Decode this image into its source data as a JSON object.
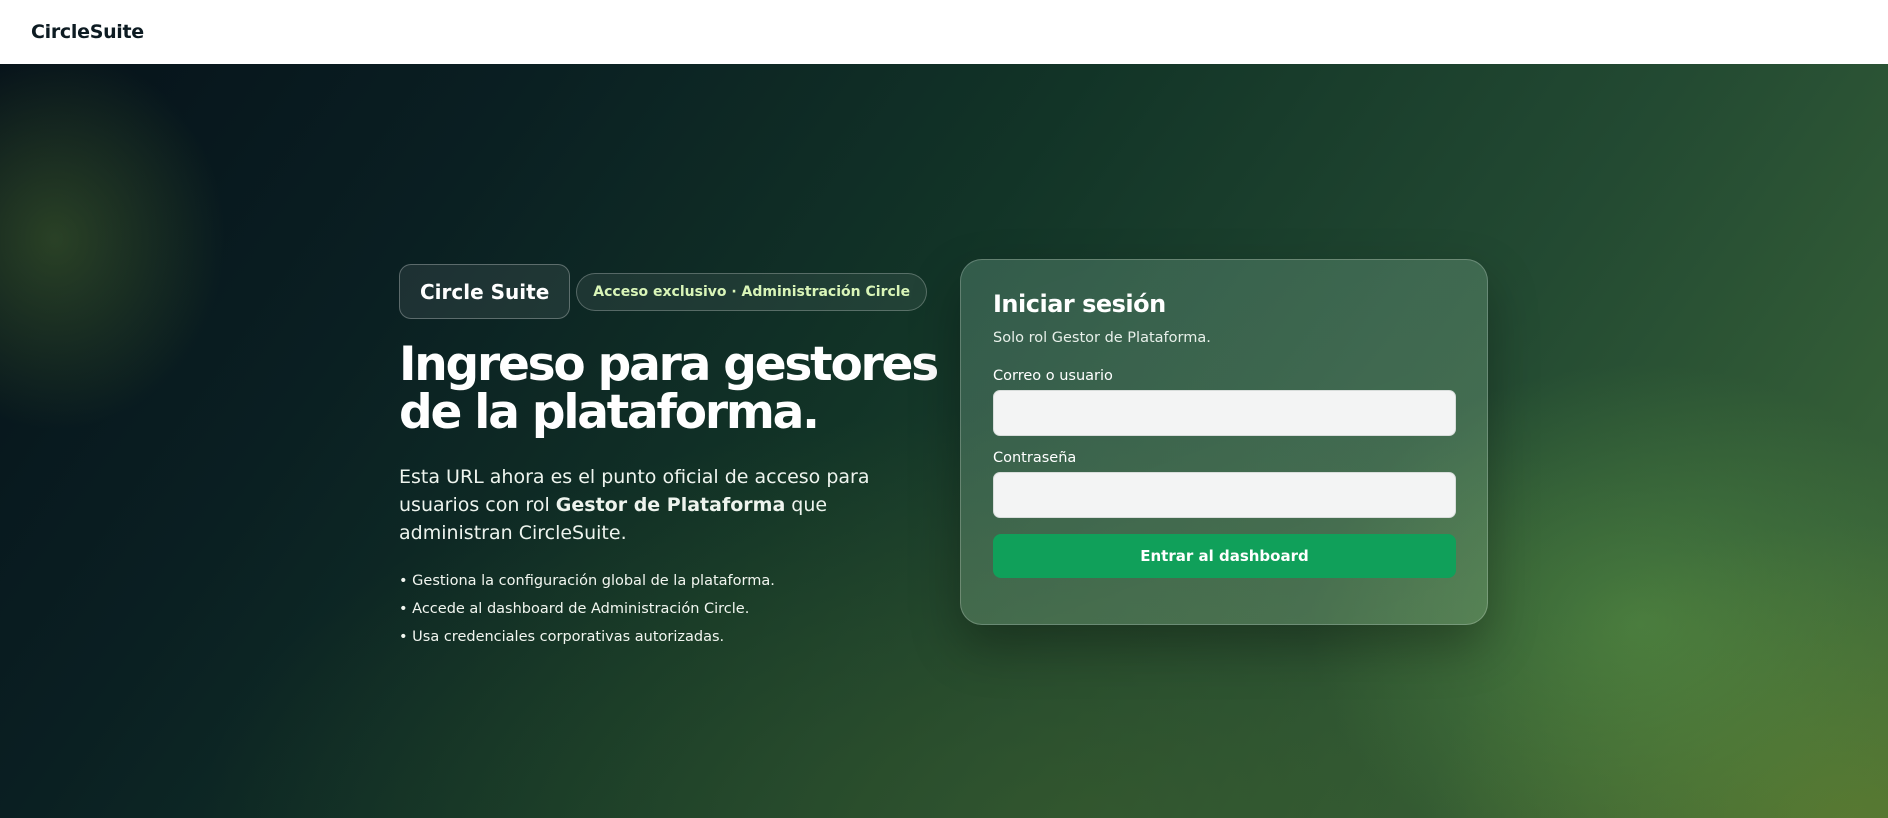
{
  "header": {
    "brand": "CircleSuite"
  },
  "hero": {
    "brand_pill": "Circle Suite",
    "badge": "Acceso exclusivo · Administración Circle",
    "headline": "Ingreso para gestores de la plataforma.",
    "description": {
      "before": "Esta URL ahora es el punto oficial de acceso para usuarios con rol ",
      "strong": "Gestor de Plataforma",
      "after": " que administran CircleSuite."
    },
    "bullets": [
      "• Gestiona la configuración global de la plataforma.",
      "• Accede al dashboard de Administración Circle.",
      "• Usa credenciales corporativas autorizadas."
    ]
  },
  "login": {
    "title": "Iniciar sesión",
    "subtitle": "Solo rol Gestor de Plataforma.",
    "user_label": "Correo o usuario",
    "user_value": "",
    "password_label": "Contraseña",
    "password_value": "",
    "submit_label": "Entrar al dashboard"
  },
  "colors": {
    "accent": "#10a05a",
    "badge_text": "#d9f5b8",
    "header_bg": "#ffffff"
  }
}
